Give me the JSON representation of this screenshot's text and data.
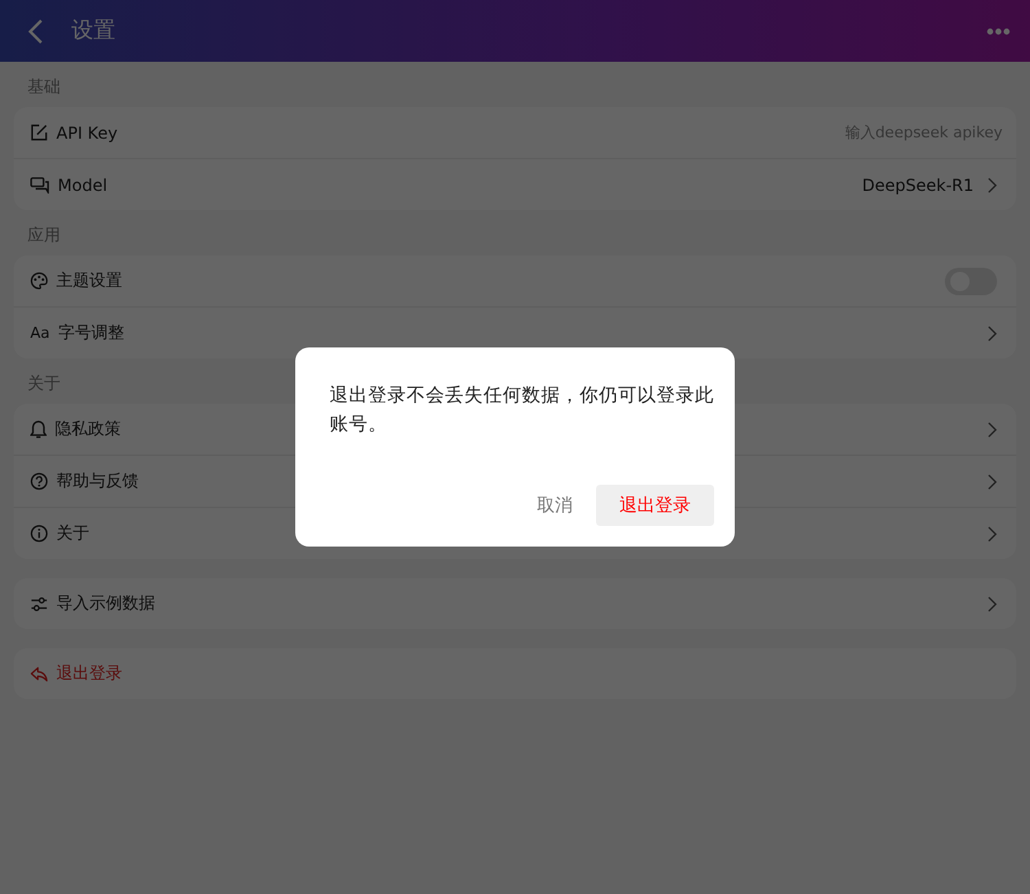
{
  "header": {
    "title": "设置"
  },
  "sections": [
    {
      "title": "基础",
      "rows": [
        {
          "kind": "input",
          "label": "API Key",
          "placeholder": "输入deepseek apikey"
        },
        {
          "kind": "value",
          "label": "Model",
          "value": "DeepSeek-R1"
        }
      ]
    },
    {
      "title": "应用",
      "rows": [
        {
          "kind": "toggle",
          "label": "主题设置",
          "on": false
        },
        {
          "kind": "link",
          "icon_text": "Aa",
          "label": "字号调整"
        }
      ]
    },
    {
      "title": "关于",
      "rows": [
        {
          "kind": "link",
          "label": "隐私政策"
        },
        {
          "kind": "link",
          "label": "帮助与反馈"
        },
        {
          "kind": "link",
          "label": "关于"
        }
      ]
    },
    {
      "rows": [
        {
          "kind": "link",
          "label": "导入示例数据"
        }
      ]
    },
    {
      "rows": [
        {
          "kind": "danger",
          "label": "退出登录"
        }
      ]
    }
  ],
  "dialog": {
    "message": "退出登录不会丢失任何数据，你仍可以登录此账号。",
    "cancel": "取消",
    "confirm": "退出登录"
  }
}
